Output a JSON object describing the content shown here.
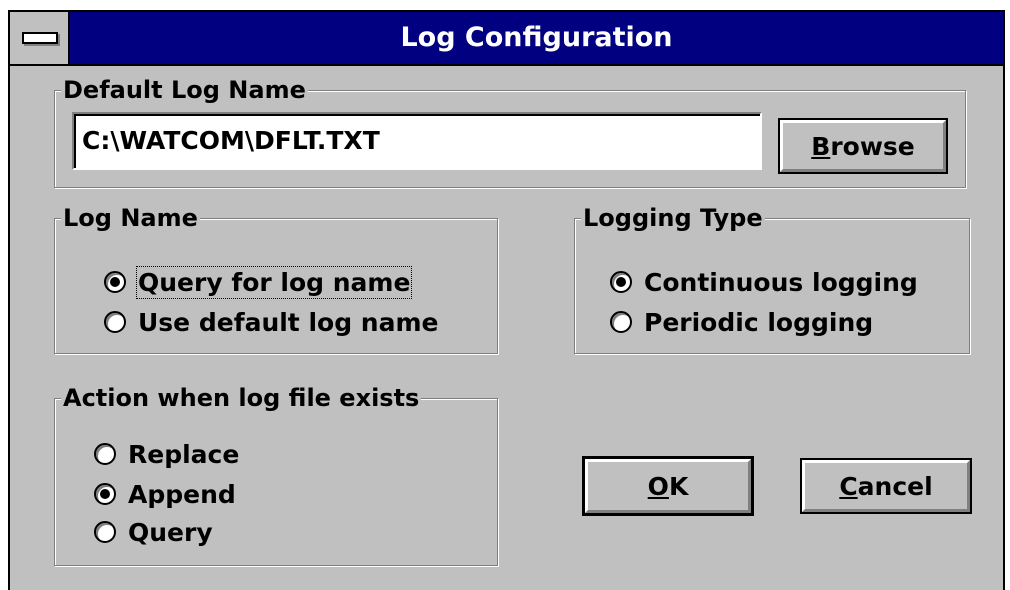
{
  "window": {
    "title": "Log Configuration"
  },
  "default_log_name": {
    "group_label": "Default Log Name",
    "value": "C:\\WATCOM\\DFLT.TXT",
    "browse_label_accel": "B",
    "browse_label_rest": "rowse"
  },
  "log_name": {
    "group_label": "Log Name",
    "options": [
      {
        "label": "Query for log name",
        "checked": true
      },
      {
        "label": "Use default log name",
        "checked": false
      }
    ]
  },
  "logging_type": {
    "group_label": "Logging Type",
    "options": [
      {
        "label": "Continuous logging",
        "checked": true
      },
      {
        "label": "Periodic logging",
        "checked": false
      }
    ]
  },
  "action_exists": {
    "group_label": "Action when log file exists",
    "options": [
      {
        "label": "Replace",
        "checked": false
      },
      {
        "label": "Append",
        "checked": true
      },
      {
        "label": "Query",
        "checked": false
      }
    ]
  },
  "buttons": {
    "ok_accel": "O",
    "ok_rest": "K",
    "cancel_accel": "C",
    "cancel_rest": "ancel"
  },
  "colors": {
    "title_bar": "#000080",
    "dialog_face": "#c0c0c0"
  }
}
